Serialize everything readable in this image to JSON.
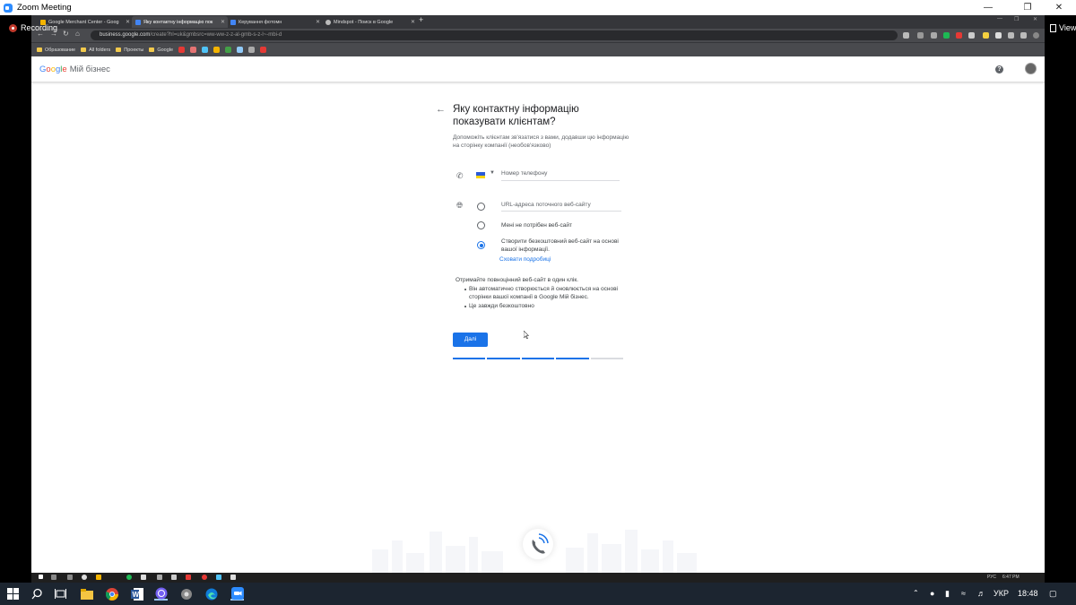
{
  "zoom": {
    "title": "Zoom Meeting",
    "recording": "Recording",
    "view": "View"
  },
  "browser": {
    "tabs": [
      {
        "label": "Google Merchant Center - Goog",
        "color": "#f4b400"
      },
      {
        "label": "Яку контактну інформацію пок",
        "color": "#4285f4"
      },
      {
        "label": "Керування фотомн",
        "color": "#4285f4"
      },
      {
        "label": "Mindspot - Поиск в Google",
        "color": "#bbbbbb"
      }
    ],
    "url_host": "business.google.com",
    "url_path": "/create?hl=uk&gmbsrc=ww-ww-z-z-al-gmb-s-z-l~-mbi-d",
    "bookmarks": [
      "Образование",
      "All folders",
      "Проекты",
      "Google"
    ]
  },
  "app": {
    "logo": {
      "g": "G",
      "o1": "o",
      "o2": "o",
      "g2": "g",
      "l": "l",
      "e": "e",
      "product": "Мій бізнес"
    },
    "help": "?"
  },
  "form": {
    "title": "Яку контактну інформацію показувати клієнтам?",
    "subtitle": "Допоможіть клієнтам зв'язатися з вами, додавши цю інформацію на сторінку компанії (необов'язково)",
    "phone_placeholder": "Номер телефону",
    "url_placeholder": "URL-адреса поточного веб-сайту",
    "option_no_site": "Мені не потрібен веб-сайт",
    "option_create_site": "Створити безкоштовний веб-сайт на основі вашої інформації.",
    "hide_details": "Сховати подробиці",
    "info_intro": "Отримайте повноцінний веб-сайт в один клік.",
    "info_bullets": [
      "Він автоматично створюється й оновлюється на основі сторінки вашої компанії в Google Мій бізнес.",
      "Це завжди безкоштовно"
    ],
    "next_button": "Далі",
    "progress_steps_done": 4,
    "progress_steps_total": 5
  },
  "remote_tray": {
    "lang": "РУС",
    "time": "6:47 PM"
  },
  "taskbar": {
    "lang": "УКР",
    "time": "18:48"
  }
}
